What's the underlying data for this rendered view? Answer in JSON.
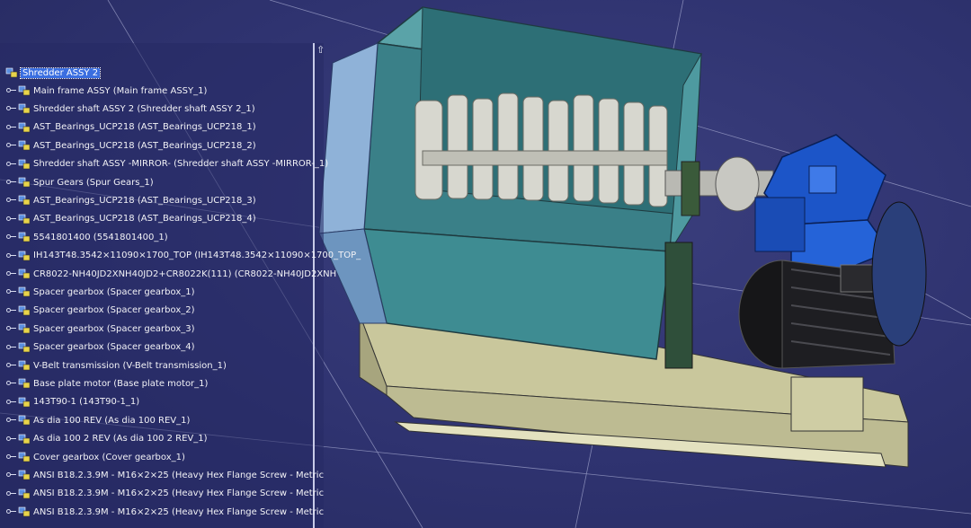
{
  "tree": {
    "root": "Shredder ASSY 2",
    "items": [
      "Main frame ASSY (Main frame ASSY_1)",
      "Shredder shaft ASSY 2 (Shredder shaft ASSY 2_1)",
      "AST_Bearings_UCP218 (AST_Bearings_UCP218_1)",
      "AST_Bearings_UCP218 (AST_Bearings_UCP218_2)",
      "Shredder shaft ASSY -MIRROR- (Shredder shaft ASSY -MIRROR-_1)",
      "Spur Gears (Spur Gears_1)",
      "AST_Bearings_UCP218 (AST_Bearings_UCP218_3)",
      "AST_Bearings_UCP218 (AST_Bearings_UCP218_4)",
      "5541801400 (5541801400_1)",
      "IH143T48.3542×11090×1700_TOP (IH143T48.3542×11090×1700_TOP_",
      "CR8022-NH40JD2XNH40JD2+CR8022K(111) (CR8022-NH40JD2XNH",
      "Spacer gearbox (Spacer gearbox_1)",
      "Spacer gearbox (Spacer gearbox_2)",
      "Spacer gearbox (Spacer gearbox_3)",
      "Spacer gearbox (Spacer gearbox_4)",
      "V-Belt transmission (V-Belt transmission_1)",
      "Base plate motor (Base plate motor_1)",
      "143T90-1 (143T90-1_1)",
      "As dia 100 REV (As dia 100 REV_1)",
      "As dia 100 2 REV (As dia 100 2 REV_1)",
      "Cover gearbox (Cover gearbox_1)",
      "ANSI B18.2.3.9M - M16×2×25 (Heavy Hex Flange Screw - Metric",
      "ANSI B18.2.3.9M - M16×2×25 (Heavy Hex Flange Screw - Metric",
      "ANSI B18.2.3.9M - M16×2×25 (Heavy Hex Flange Screw - Metric"
    ]
  },
  "colors": {
    "background": "#2f3370",
    "selection": "#3a6ee0",
    "hopper": "#3e8c92",
    "frame": "#d8d6b0",
    "motor": "#1c1c20",
    "gearbox": "#1c55c8"
  },
  "icons": {
    "part": "product-part-icon",
    "connector": "tree-connector-icon",
    "scroll": "scroll-up-icon"
  }
}
